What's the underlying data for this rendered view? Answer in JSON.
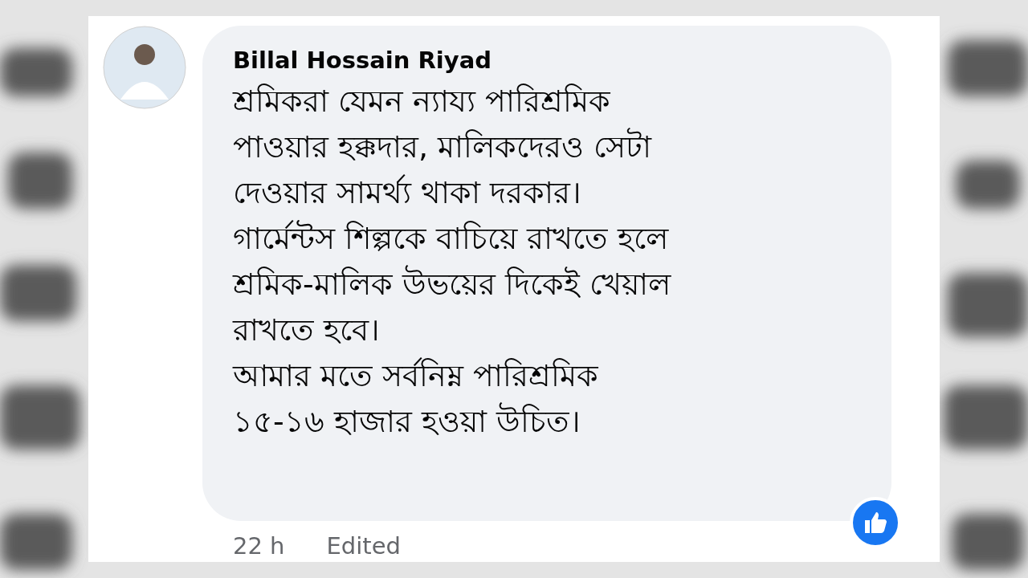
{
  "comment": {
    "author": "Billal Hossain Riyad",
    "text": "শ্রমিকরা যেমন ন্যায্য পারিশ্রমিক\nপাওয়ার হক্কদার, মালিকদেরও সেটা\nদেওয়ার সামর্থ্য থাকা দরকার।\nগার্মেন্টস শিল্পকে বাচিয়ে রাখতে হলে\nশ্রমিক-মালিক উভয়ের দিকেই খেয়াল\nরাখতে হবে।\nআমার মতে সর্বনিম্ন পারিশ্রমিক\n১৫-১৬ হাজার হওয়া উচিত।",
    "time": "22 h",
    "edited": "Edited"
  }
}
